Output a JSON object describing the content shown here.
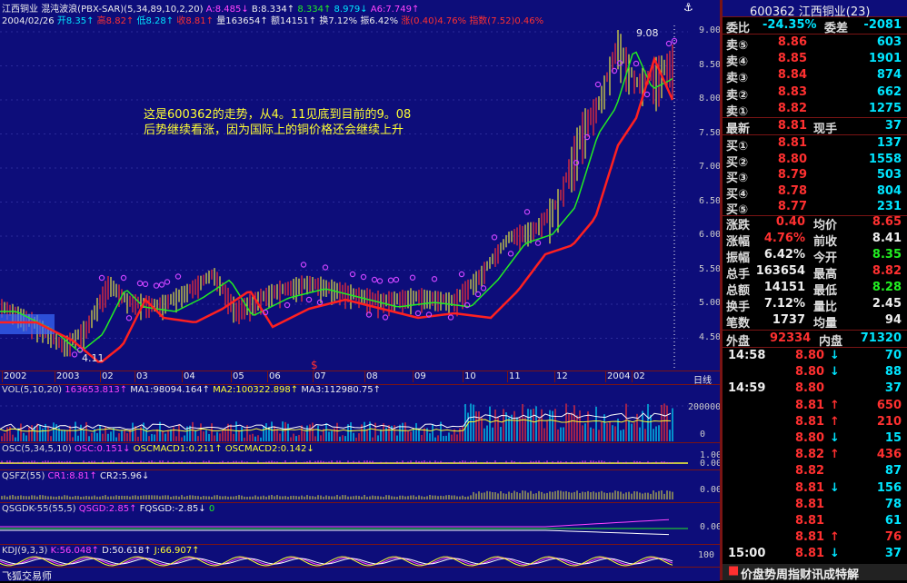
{
  "colors": {
    "chart_bg": "#0d0d7a",
    "up": "#ff3030",
    "down": "#22ee22",
    "accent": "#00e5ff",
    "ma_red": "#ff2020",
    "sar_circle": "#cc44ff",
    "annotation": "#ffff33"
  },
  "header": {
    "stock_name": "江西铜业",
    "indicator_title": "混沌波浪(PBX-SAR)(5,34,89,10,2,20)",
    "a_label": "A:8.485↓",
    "b_label": "B:8.334↑",
    "c_label": "8.334↑",
    "d_label": "8.979↓",
    "a6_label": "A6:7.749↑",
    "date": "2004/02/26",
    "open_label": "开8.35↑",
    "high_label": "高8.82↑",
    "low_label": "低8.28↑",
    "close_label": "收8.81↑",
    "volume_label": "量163654↑",
    "amount_label": "额14151↑",
    "turnover_label": "换7.12%",
    "amplitude_label": "振6.42%",
    "change_label": "涨(0.40)4.76%",
    "index_label": "指数(7.52)0.46%"
  },
  "annotation": {
    "line1": "这是600362的走势，从4。11见底到目前的9。08",
    "line2": "后势继续看涨，因为国际上的铜价格还会继续上升",
    "high_marker": "9.08",
    "low_marker": "4.11"
  },
  "price_axis": [
    "9.00",
    "8.50",
    "8.00",
    "7.50",
    "7.00",
    "6.50",
    "6.00",
    "5.50",
    "5.00",
    "4.50"
  ],
  "time_axis": {
    "labels": [
      "2002",
      "2003",
      "02",
      "03",
      "04",
      "05",
      "06",
      "07",
      "08",
      "09",
      "10",
      "11",
      "12",
      "2004",
      "02"
    ],
    "period": "日线",
    "marker": "$"
  },
  "panels": {
    "vol": {
      "title": "VOL(5,10,20)",
      "v1": "163653.813↑",
      "ma1": "MA1:98094.164↑",
      "ma2": "MA2:100322.898↑",
      "ma3": "MA3:112980.75↑",
      "axis_top": "200000",
      "axis_bot": "0"
    },
    "osc": {
      "title": "OSC(5,34,5,10)",
      "osc": "OSC:0.151↓",
      "m1": "OSCMACD1:0.211↑",
      "m2": "OSCMACD2:0.142↓",
      "axis_top": "1.00",
      "axis_bot": "0.00"
    },
    "qsfz": {
      "title": "QSFZ(55)",
      "cr1": "CR1:8.81↑",
      "cr2": "CR2:5.96↓",
      "axis": "0.00"
    },
    "qsgdk": {
      "title": "QSGDK-55(55,5)",
      "qsgd": "QSGD:2.85↑",
      "fqsgd": "FQSGD:-2.85↓",
      "zero": "0",
      "axis": "0.00"
    },
    "kdj": {
      "title": "KDJ(9,3,3)",
      "k": "K:56.048↑",
      "d": "D:50.618↑",
      "j": "J:66.907↑",
      "axis": "100"
    }
  },
  "status_bar": {
    "left": "飞狐交易师",
    "right": "价盘势周指财讯成特解"
  },
  "quote": {
    "title": "600362 江西铜业(23)",
    "weibi_label": "委比",
    "weibi_value": "-24.35%",
    "weicha_label": "委差",
    "weicha_value": "-2081",
    "asks": [
      {
        "label": "卖⑤",
        "price": "8.86",
        "vol": "603"
      },
      {
        "label": "卖④",
        "price": "8.85",
        "vol": "1901"
      },
      {
        "label": "卖③",
        "price": "8.84",
        "vol": "874"
      },
      {
        "label": "卖②",
        "price": "8.83",
        "vol": "662"
      },
      {
        "label": "卖①",
        "price": "8.82",
        "vol": "1275"
      }
    ],
    "last": {
      "label": "最新",
      "price": "8.81",
      "now_label": "现手",
      "now_vol": "37"
    },
    "bids": [
      {
        "label": "买①",
        "price": "8.81",
        "vol": "137"
      },
      {
        "label": "买②",
        "price": "8.80",
        "vol": "1558"
      },
      {
        "label": "买③",
        "price": "8.79",
        "vol": "503"
      },
      {
        "label": "买④",
        "price": "8.78",
        "vol": "804"
      },
      {
        "label": "买⑤",
        "price": "8.77",
        "vol": "231"
      }
    ],
    "stats": [
      {
        "l1": "涨跌",
        "v1": "0.40",
        "c1": "red",
        "l2": "均价",
        "v2": "8.65",
        "c2": "red"
      },
      {
        "l1": "涨幅",
        "v1": "4.76%",
        "c1": "red",
        "l2": "前收",
        "v2": "8.41",
        "c2": "white"
      },
      {
        "l1": "振幅",
        "v1": "6.42%",
        "c1": "white",
        "l2": "今开",
        "v2": "8.35",
        "c2": "green"
      },
      {
        "l1": "总手",
        "v1": "163654",
        "c1": "white",
        "l2": "最高",
        "v2": "8.82",
        "c2": "red"
      },
      {
        "l1": "总额",
        "v1": "14151",
        "c1": "white",
        "l2": "最低",
        "v2": "8.28",
        "c2": "green"
      },
      {
        "l1": "换手",
        "v1": "7.12%",
        "c1": "white",
        "l2": "量比",
        "v2": "2.45",
        "c2": "white"
      },
      {
        "l1": "笔数",
        "v1": "1737",
        "c1": "white",
        "l2": "均量",
        "v2": "94",
        "c2": "white"
      }
    ],
    "outer_label": "外盘",
    "outer_value": "92334",
    "inner_label": "内盘",
    "inner_value": "71320",
    "ticks": [
      {
        "time": "14:58",
        "price": "8.80",
        "dir": "↓",
        "vol": "70"
      },
      {
        "time": "",
        "price": "8.80",
        "dir": "↓",
        "vol": "88"
      },
      {
        "time": "14:59",
        "price": "8.80",
        "dir": "",
        "vol": "37"
      },
      {
        "time": "",
        "price": "8.81",
        "dir": "↑",
        "vol": "650"
      },
      {
        "time": "",
        "price": "8.81",
        "dir": "↑",
        "vol": "210"
      },
      {
        "time": "",
        "price": "8.80",
        "dir": "↓",
        "vol": "15"
      },
      {
        "time": "",
        "price": "8.82",
        "dir": "↑",
        "vol": "436"
      },
      {
        "time": "",
        "price": "8.82",
        "dir": "",
        "vol": "87"
      },
      {
        "time": "",
        "price": "8.81",
        "dir": "↓",
        "vol": "156"
      },
      {
        "time": "",
        "price": "8.81",
        "dir": "",
        "vol": "78"
      },
      {
        "time": "",
        "price": "8.81",
        "dir": "",
        "vol": "61"
      },
      {
        "time": "",
        "price": "8.81",
        "dir": "↑",
        "vol": "76"
      },
      {
        "time": "15:00",
        "price": "8.81",
        "dir": "↓",
        "vol": "37"
      }
    ]
  }
}
